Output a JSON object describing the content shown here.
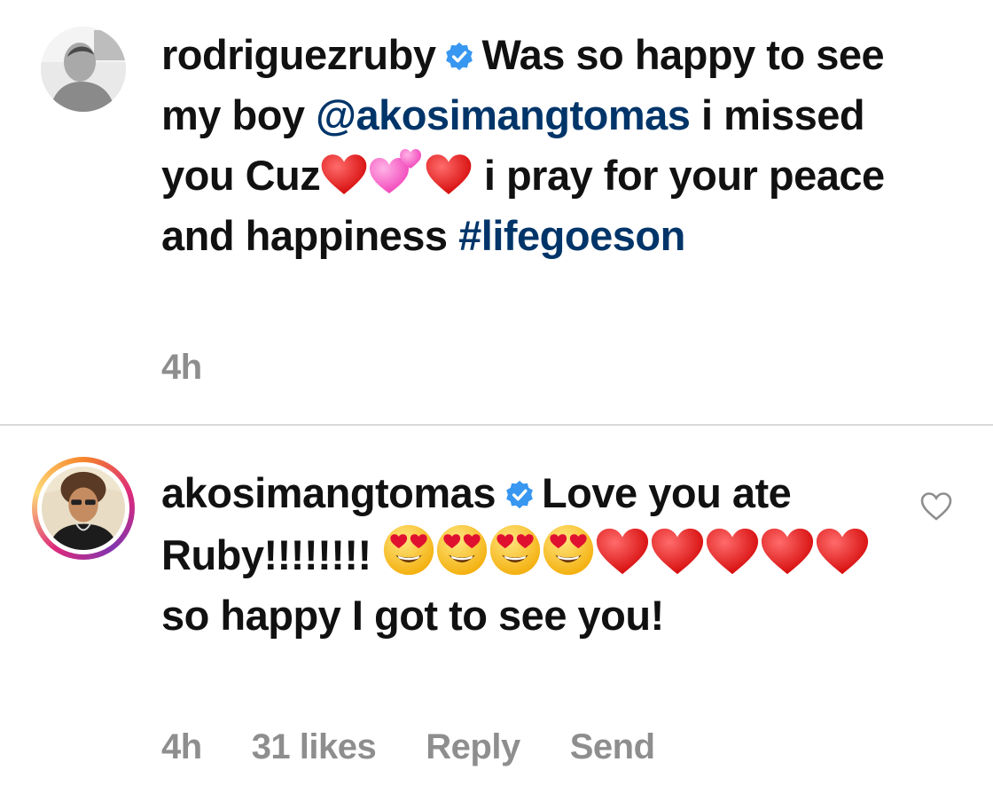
{
  "comments": [
    {
      "username": "rodriguezruby",
      "text_part1": "Was so happy to see my boy ",
      "mention": "@akosimangtomas",
      "text_part2": " i missed you Cuz",
      "text_part3": " i pray for your peace and happiness ",
      "hashtag": "#lifegoeson",
      "time": "4h"
    },
    {
      "username": "akosimangtomas",
      "text_part1": "Love you ate Ruby!!!!!!!! ",
      "text_part2": " so happy I got to see you!",
      "time": "4h",
      "likes": "31 likes",
      "reply_label": "Reply",
      "send_label": "Send"
    }
  ],
  "icons": {
    "verified": "verified-badge-icon",
    "like": "heart-outline-icon",
    "emoji_heart": "red-heart-emoji",
    "emoji_two_hearts": "two-hearts-emoji",
    "emoji_heart_eyes": "heart-eyes-emoji"
  },
  "colors": {
    "link": "#003569",
    "meta": "#8e8e8e",
    "verified": "#3897f0"
  }
}
